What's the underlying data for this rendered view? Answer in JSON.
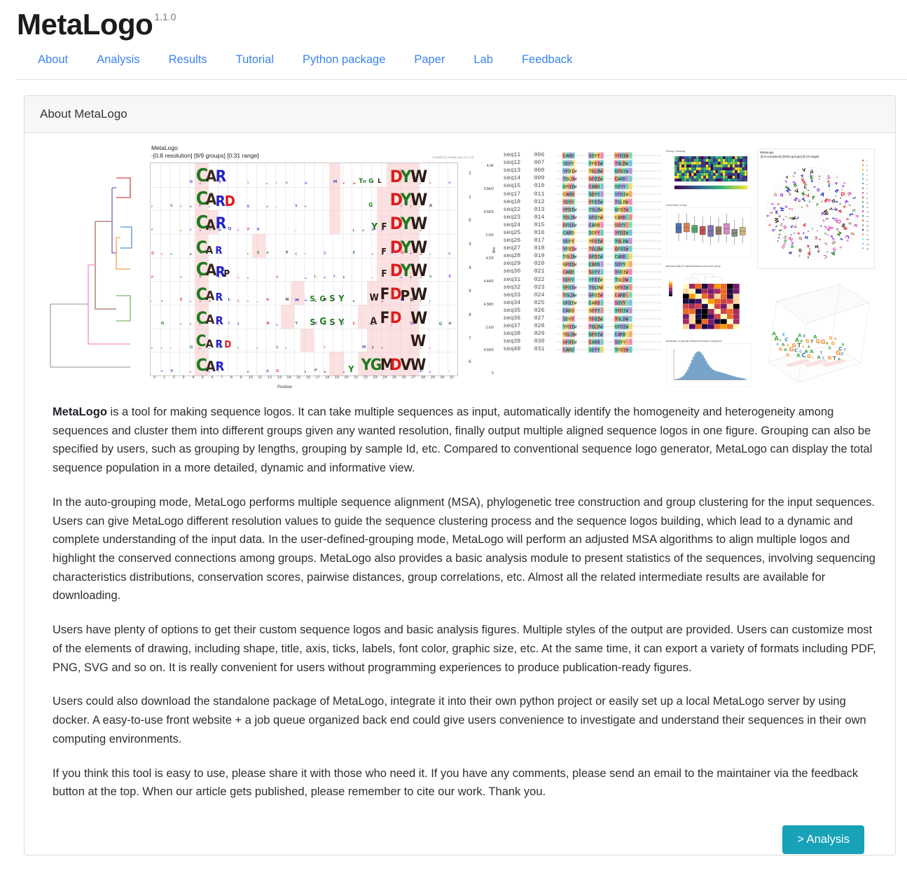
{
  "header": {
    "brand": "MetaLogo",
    "version": "1.1.0",
    "nav": [
      {
        "label": "About",
        "name": "nav-about"
      },
      {
        "label": "Analysis",
        "name": "nav-analysis"
      },
      {
        "label": "Results",
        "name": "nav-results"
      },
      {
        "label": "Tutorial",
        "name": "nav-tutorial"
      },
      {
        "label": "Python package",
        "name": "nav-python-package"
      },
      {
        "label": "Paper",
        "name": "nav-paper"
      },
      {
        "label": "Lab",
        "name": "nav-lab"
      },
      {
        "label": "Feedback",
        "name": "nav-feedback"
      }
    ]
  },
  "card": {
    "title": "About MetaLogo"
  },
  "figure": {
    "logo_panel": {
      "title_line1": "MetaLogo",
      "title_line2": "-[0.8 resolution] [9/9 groups] [0:31 range]",
      "credit": "Created by MetaLogo (v1.1.0)",
      "xlabel": "Position",
      "ylabel": "Bits",
      "xticks": [
        "0",
        "1",
        "2",
        "3",
        "4",
        "5",
        "6",
        "7",
        "8",
        "9",
        "10",
        "11",
        "12",
        "13",
        "14",
        "15",
        "16",
        "17",
        "18",
        "19",
        "20",
        "21",
        "22",
        "23",
        "24",
        "25",
        "26",
        "27",
        "28",
        "29",
        "30",
        "31"
      ],
      "group_numbers": [
        "2",
        "1",
        "5",
        "3",
        "4",
        "9",
        "8",
        "7",
        "6"
      ],
      "yticks": [
        "4.04",
        "3.6b/0",
        "4.56/0",
        "2.6/0",
        "4.2/0",
        "4.44/0",
        "4.58/0",
        "2.6/0",
        "4.56/0",
        "0"
      ]
    },
    "radial_panel": {
      "title_line1": "MetaLogo",
      "title_line2": "-[0.5 resolution] [20/22 groups] [0:19 range]"
    },
    "msa": {
      "rows": [
        {
          "name": "seq11",
          "num": "006"
        },
        {
          "name": "seq12",
          "num": "007"
        },
        {
          "name": "seq13",
          "num": "008"
        },
        {
          "name": "seq14",
          "num": "009"
        },
        {
          "name": "seq15",
          "num": "010"
        },
        {
          "name": "seq17",
          "num": "011"
        },
        {
          "name": "seq18",
          "num": "012"
        },
        {
          "name": "seq22",
          "num": "013"
        },
        {
          "name": "seq23",
          "num": "014"
        },
        {
          "name": "seq24",
          "num": "015"
        },
        {
          "name": "seq25",
          "num": "016"
        },
        {
          "name": "seq26",
          "num": "017"
        },
        {
          "name": "seq27",
          "num": "018"
        },
        {
          "name": "seq28",
          "num": "019"
        },
        {
          "name": "seq29",
          "num": "020"
        },
        {
          "name": "seq30",
          "num": "021"
        },
        {
          "name": "seq31",
          "num": "022"
        },
        {
          "name": "seq32",
          "num": "023"
        },
        {
          "name": "seq33",
          "num": "024"
        },
        {
          "name": "seq34",
          "num": "025"
        },
        {
          "name": "seq35",
          "num": "026"
        },
        {
          "name": "seq36",
          "num": "027"
        },
        {
          "name": "seq37",
          "num": "028"
        },
        {
          "name": "seq38",
          "num": "029"
        },
        {
          "name": "seq39",
          "num": "030"
        },
        {
          "name": "seq40",
          "num": "031"
        }
      ]
    },
    "analysis_panels": [
      {
        "caption": "Entropy / heatmap",
        "type": "heatmap"
      },
      {
        "caption": "conservation of logo",
        "type": "boxplot"
      },
      {
        "caption": "pairwise entity for alphabet/position level over group",
        "type": "clustermap"
      },
      {
        "caption": "distribution of pairwise distances between sequences",
        "type": "histogram"
      }
    ]
  },
  "content": {
    "paragraphs": [
      {
        "lead": "MetaLogo",
        "text": " is a tool for making sequence logos. It can take multiple sequences as input, automatically identify the homogeneity and heterogeneity among sequences and cluster them into different groups given any wanted resolution, finally output multiple aligned sequence logos in one figure. Grouping can also be specified by users, such as grouping by lengths, grouping by sample Id, etc. Compared to conventional sequence logo generator, MetaLogo can display the total sequence population in a more detailed, dynamic and informative view."
      },
      {
        "lead": "",
        "text": "In the auto-grouping mode, MetaLogo performs multiple sequence alignment (MSA), phylogenetic tree construction and group clustering for the input sequences. Users can give MetaLogo different resolution values to guide the sequence clustering process and the sequence logos building, which lead to a dynamic and complete understanding of the input data. In the user-defined-grouping mode, MetaLogo will perform an adjusted MSA algorithms to align multiple logos and highlight the conserved connections among groups. MetaLogo also provides a basic analysis module to present statistics of the sequences, involving sequencing characteristics distributions, conservation scores, pairwise distances, group correlations, etc. Almost all the related intermediate results are available for downloading."
      },
      {
        "lead": "",
        "text": "Users have plenty of options to get their custom sequence logos and basic analysis figures. Multiple styles of the output are provided. Users can customize most of the elements of drawing, including shape, title, axis, ticks, labels, font color, graphic size, etc. At the same time, it can export a variety of formats including PDF, PNG, SVG and so on. It is really convenient for users without programming experiences to produce publication-ready figures."
      },
      {
        "lead": "",
        "text": "Users could also download the standalone package of MetaLogo, integrate it into their own python project or easily set up a local MetaLogo server by using docker. A easy-to-use front website + a job queue organized back end could give users convenience to investigate and understand their sequences in their own computing environments."
      },
      {
        "lead": "",
        "text": "If you think this tool is easy to use, please share it with those who need it. If you have any comments, please send an email to the maintainer via the feedback button at the top. When our article gets published, please remember to cite our work. Thank you."
      }
    ]
  },
  "footer": {
    "analysis_button": "> Analysis"
  },
  "colors": {
    "link": "#3b82f6",
    "button": "#17a2b8",
    "card_header_bg": "#f7f7f7",
    "text": "#2b2f33"
  }
}
